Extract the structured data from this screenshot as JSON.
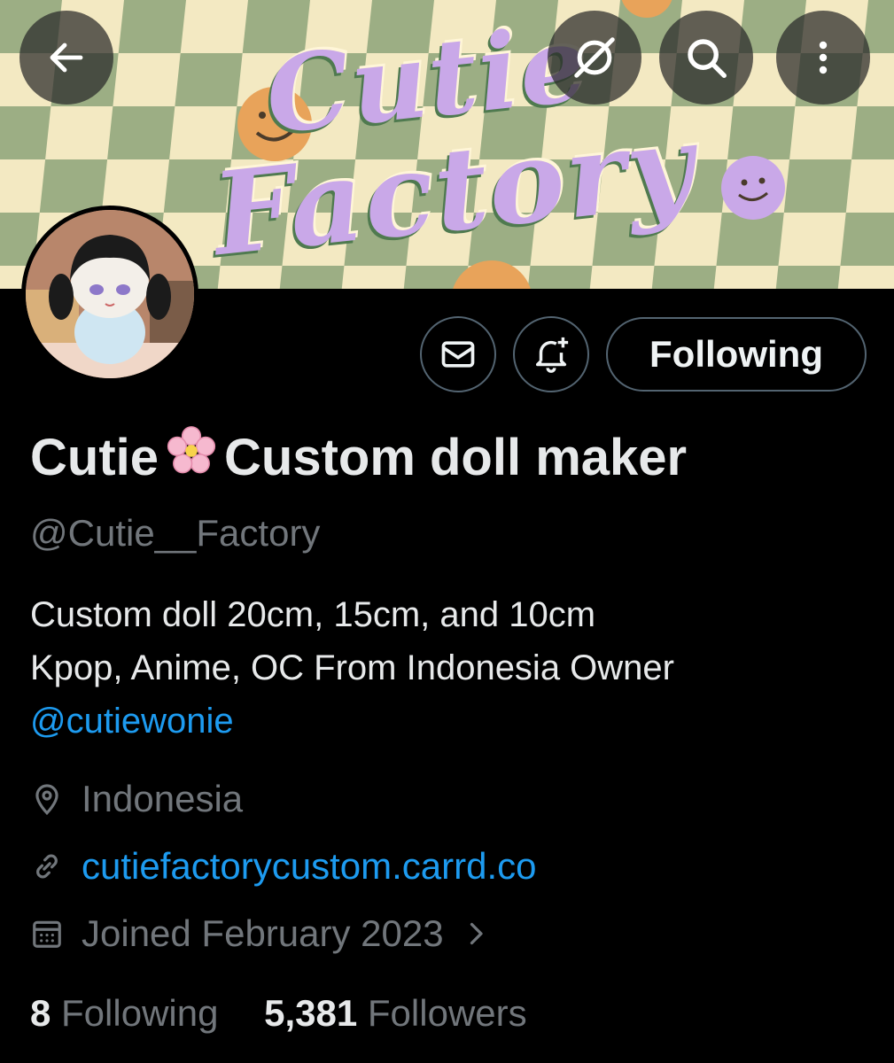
{
  "header": {
    "back_icon": "arrow-left-icon",
    "grok_icon": "grok-icon",
    "search_icon": "search-icon",
    "more_icon": "more-vertical-icon",
    "banner_text_line1": "Cutie",
    "banner_text_line2": "Factory"
  },
  "actions": {
    "message_icon": "envelope-icon",
    "notify_icon": "bell-plus-icon",
    "follow_label": "Following"
  },
  "profile": {
    "name_part1": "Cutie",
    "name_emoji": "🌸",
    "name_part2": "Custom doll maker",
    "handle": "@Cutie__Factory",
    "bio_line1": "Custom doll 20cm, 15cm, and 10cm",
    "bio_line2": "Kpop, Anime, OC From Indonesia Owner",
    "bio_mention": "@cutiewonie",
    "location": "Indonesia",
    "website": "cutiefactorycustom.carrd.co",
    "joined": "Joined February 2023",
    "following_count": "8",
    "following_label": "Following",
    "followers_count": "5,381",
    "followers_label": "Followers"
  },
  "colors": {
    "background": "#000000",
    "accent_link": "#1d9bf0",
    "muted_text": "#71767b",
    "banner_purple": "#c9a8e8",
    "banner_green": "#9cae84",
    "banner_cream": "#f3e9c2"
  }
}
